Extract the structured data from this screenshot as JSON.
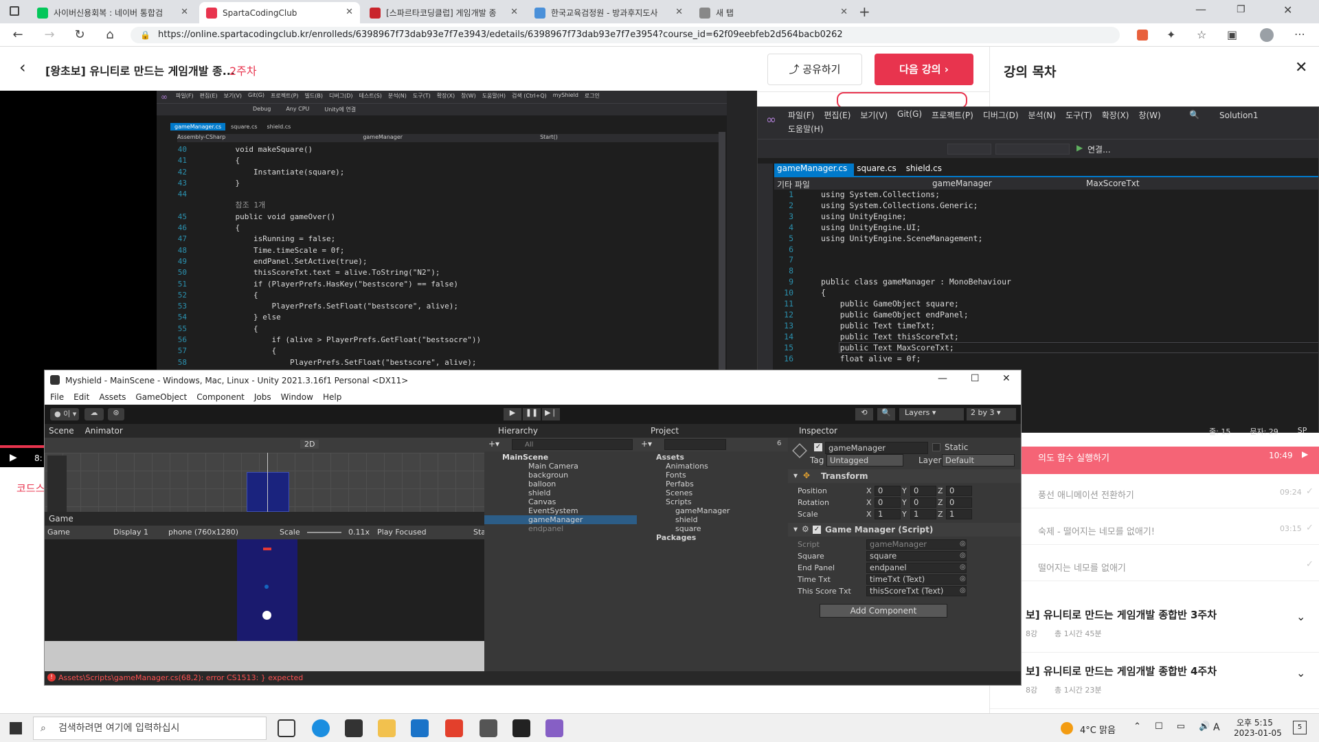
{
  "browser": {
    "tabs": [
      {
        "label": "사이버신용회복 : 네이버 통합검",
        "color": "#03c75a"
      },
      {
        "label": "SpartaCodingClub",
        "color": "#e8344e"
      },
      {
        "label": "[스파르타코딩클럽] 게임개발 종",
        "color": "#c9252c"
      },
      {
        "label": "한국교육검정원 - 방과후지도사",
        "color": "#4a90d9"
      },
      {
        "label": "새 탭",
        "color": "#888888"
      }
    ],
    "url": "https://online.spartacodingclub.kr/enrolleds/6398967f73dab93e7f7e3943/edetails/6398967f73dab93e7f7e3954?course_id=62f09eebfeb2d564bacb0262"
  },
  "sparta": {
    "course_title": "[왕초보] 유니티로 만드는 게임개발 종...",
    "week": "2주차",
    "share": "공유하기",
    "next": "다음 강의 ›",
    "toc_title": "강의 목차",
    "red_bar_text": "의도 함수 실행하기",
    "red_bar_time": "10:49",
    "lessons": [
      {
        "title": "풍선 애니메이션 전환하기",
        "time": "09:24"
      },
      {
        "title": "숙제 - 떨어지는 네모를 없애기!",
        "time": "03:15"
      },
      {
        "title": "떨어지는 네모를 없애기",
        "time": ""
      }
    ],
    "weeks": [
      {
        "title": "보] 유니티로 만드는 게임개발 종합반 3주차",
        "meta1": "8강",
        "meta2": "총 1시간 45분"
      },
      {
        "title": "보] 유니티로 만드는 게임개발 종합반 4주차",
        "meta1": "8강",
        "meta2": "총 1시간 23분"
      }
    ],
    "left_label": "코드스",
    "play_time": "8:"
  },
  "vs_back": {
    "menu": [
      "파일(F)",
      "편집(E)",
      "보기(V)",
      "Git(G)",
      "프로젝트(P)",
      "빌드(B)",
      "디버그(D)",
      "테스트(S)",
      "분석(N)",
      "도구(T)",
      "확장(X)",
      "창(W)",
      "도움말(H)",
      "검색 (Ctrl+Q)",
      "myShield",
      "로그인"
    ],
    "toolbar": [
      "Debug",
      "Any CPU",
      "Unity에 연결"
    ],
    "tabs": [
      "gameManager.cs",
      "square.cs",
      "shield.cs"
    ],
    "nav": [
      "Assembly-CSharp",
      "gameManager",
      "Start()"
    ],
    "lines": [
      {
        "n": "40",
        "t": "    void makeSquare()"
      },
      {
        "n": "41",
        "t": "    {"
      },
      {
        "n": "42",
        "t": "        Instantiate(square);"
      },
      {
        "n": "43",
        "t": "    }"
      },
      {
        "n": "44",
        "t": ""
      },
      {
        "n": "",
        "t": "    참조 1개"
      },
      {
        "n": "45",
        "t": "    public void gameOver()"
      },
      {
        "n": "46",
        "t": "    {"
      },
      {
        "n": "47",
        "t": "        isRunning = false;"
      },
      {
        "n": "48",
        "t": "        Time.timeScale = 0f;"
      },
      {
        "n": "49",
        "t": "        endPanel.SetActive(true);"
      },
      {
        "n": "50",
        "t": "        thisScoreTxt.text = alive.ToString(\"N2\");"
      },
      {
        "n": "51",
        "t": "        if (PlayerPrefs.HasKey(\"bestscore\") == false)"
      },
      {
        "n": "52",
        "t": "        {"
      },
      {
        "n": "53",
        "t": "            PlayerPrefs.SetFloat(\"bestscore\", alive);"
      },
      {
        "n": "54",
        "t": "        } else"
      },
      {
        "n": "55",
        "t": "        {"
      },
      {
        "n": "56",
        "t": "            if (alive > PlayerPrefs.GetFloat(\"bestsocre\"))"
      },
      {
        "n": "57",
        "t": "            {"
      },
      {
        "n": "58",
        "t": "                PlayerPrefs.SetFloat(\"bestscore\", alive);"
      }
    ]
  },
  "vs_front": {
    "menu": [
      "파일(F)",
      "편집(E)",
      "보기(V)",
      "Git(G)",
      "프로젝트(P)",
      "디버그(D)",
      "분석(N)",
      "도구(T)",
      "확장(X)",
      "창(W)",
      "도움말(H)"
    ],
    "solution": "Solution1",
    "run": "연결...",
    "tabs": [
      "gameManager.cs",
      "square.cs",
      "shield.cs"
    ],
    "nav": [
      "기타 파일",
      "gameManager",
      "MaxScoreTxt"
    ],
    "status": [
      "줄: 15",
      "문자: 29",
      "SP"
    ],
    "lines": [
      {
        "n": "1",
        "t": "using System.Collections;"
      },
      {
        "n": "2",
        "t": "using System.Collections.Generic;"
      },
      {
        "n": "3",
        "t": "using UnityEngine;"
      },
      {
        "n": "4",
        "t": "using UnityEngine.UI;"
      },
      {
        "n": "5",
        "t": "using UnityEngine.SceneManagement;"
      },
      {
        "n": "6",
        "t": ""
      },
      {
        "n": "7",
        "t": ""
      },
      {
        "n": "8",
        "t": ""
      },
      {
        "n": "9",
        "t": "public class gameManager : MonoBehaviour"
      },
      {
        "n": "10",
        "t": "{"
      },
      {
        "n": "11",
        "t": "    public GameObject square;"
      },
      {
        "n": "12",
        "t": "    public GameObject endPanel;"
      },
      {
        "n": "13",
        "t": "    public Text timeTxt;"
      },
      {
        "n": "14",
        "t": "    public Text thisScoreTxt;"
      },
      {
        "n": "15",
        "t": "    public Text MaxScoreTxt;"
      },
      {
        "n": "16",
        "t": "    float alive = 0f;"
      }
    ]
  },
  "unity": {
    "title": "Myshield - MainScene - Windows, Mac, Linux - Unity 2021.3.16f1 Personal <DX11>",
    "menu": [
      "File",
      "Edit",
      "Assets",
      "GameObject",
      "Component",
      "Jobs",
      "Window",
      "Help"
    ],
    "layers": "Layers",
    "layout": "2 by 3",
    "scene_tabs": [
      "Scene",
      "Animator"
    ],
    "game": {
      "tab": "Game",
      "mode": "Game",
      "display": "Display 1",
      "res": "phone (760x1280)",
      "scale_label": "Scale",
      "scale": "0.11x",
      "play": "Play Focused",
      "stats": "Sta"
    },
    "hierarchy": {
      "tab": "Hierarchy",
      "search": "All",
      "scene": "MainScene",
      "items": [
        "Main Camera",
        "backgroun",
        "balloon",
        "shield",
        "Canvas",
        "EventSystem",
        "gameManager",
        "endpanel"
      ],
      "selected": "gameManager"
    },
    "project": {
      "tab": "Project",
      "count": "6",
      "tree": [
        "Assets",
        "Animations",
        "Fonts",
        "Perfabs",
        "Scenes",
        "Scripts",
        "gameManager",
        "shield",
        "square",
        "Packages"
      ]
    },
    "inspector": {
      "tab": "Inspector",
      "name": "gameManager",
      "static": "Static",
      "tag_label": "Tag",
      "tag": "Untagged",
      "layer_label": "Layer",
      "layer": "Default",
      "transform": "Transform",
      "rows": [
        {
          "label": "Position",
          "x": "0",
          "y": "0",
          "z": "0"
        },
        {
          "label": "Rotation",
          "x": "0",
          "y": "0",
          "z": "0"
        },
        {
          "label": "Scale",
          "x": "1",
          "y": "1",
          "z": "1"
        }
      ],
      "script_comp": "Game Manager (Script)",
      "props": [
        {
          "label": "Script",
          "value": "gameManager"
        },
        {
          "label": "Square",
          "value": "square"
        },
        {
          "label": "End Panel",
          "value": "endpanel"
        },
        {
          "label": "Time Txt",
          "value": "timeTxt (Text)"
        },
        {
          "label": "This Score Txt",
          "value": "thisScoreTxt (Text)"
        }
      ],
      "add": "Add Component"
    },
    "error": "Assets\\Scripts\\gameManager.cs(68,2): error CS1513: } expected",
    "twod": "2D"
  },
  "taskbar": {
    "search": "검색하려면 여기에 입력하십시",
    "weather": "4°C 맑음",
    "ime": "A",
    "time": "오후 5:15",
    "date": "2023-01-05",
    "notif": "5"
  }
}
